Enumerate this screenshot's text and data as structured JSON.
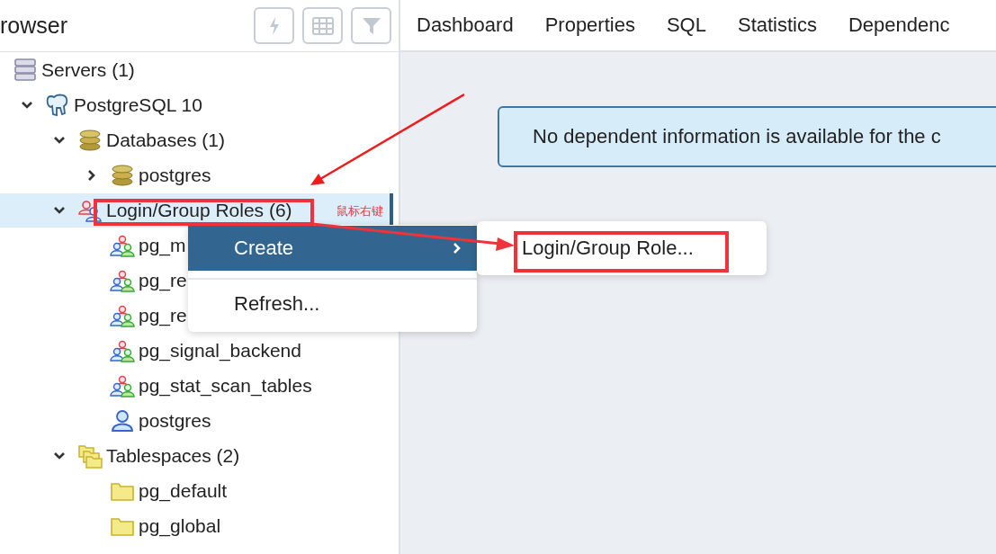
{
  "sidebar": {
    "title": "rowser"
  },
  "tree": [
    {
      "label": "Servers (1)",
      "kind": "servers",
      "selected": false,
      "children": [
        {
          "label": "PostgreSQL 10",
          "kind": "server",
          "expanded": true,
          "selected": false,
          "children": [
            {
              "label": "Databases (1)",
              "kind": "databases",
              "expanded": true,
              "selected": false,
              "children": [
                {
                  "label": "postgres",
                  "kind": "database",
                  "expanded": false,
                  "selected": false
                }
              ]
            },
            {
              "label": "Login/Group Roles (6)",
              "kind": "roles",
              "expanded": true,
              "selected": true,
              "children": [
                {
                  "label": "pg_m",
                  "kind": "group_role",
                  "selected": false
                },
                {
                  "label": "pg_re",
                  "kind": "group_role",
                  "selected": false
                },
                {
                  "label": "pg_re",
                  "kind": "group_role",
                  "selected": false
                },
                {
                  "label": "pg_signal_backend",
                  "kind": "group_role",
                  "selected": false
                },
                {
                  "label": "pg_stat_scan_tables",
                  "kind": "group_role",
                  "selected": false
                },
                {
                  "label": "postgres",
                  "kind": "login_role",
                  "selected": false
                }
              ]
            },
            {
              "label": "Tablespaces (2)",
              "kind": "tablespaces",
              "expanded": true,
              "selected": false,
              "children": [
                {
                  "label": "pg_default",
                  "kind": "tablespace",
                  "selected": false
                },
                {
                  "label": "pg_global",
                  "kind": "tablespace",
                  "selected": false
                }
              ]
            }
          ]
        }
      ]
    }
  ],
  "tabs": [
    {
      "label": "Dashboard",
      "selected": false
    },
    {
      "label": "Properties",
      "selected": false
    },
    {
      "label": "SQL",
      "selected": false
    },
    {
      "label": "Statistics",
      "selected": false
    },
    {
      "label": "Dependenc",
      "selected": false
    }
  ],
  "alert": {
    "text": "No dependent information is available for the c"
  },
  "context_menu": {
    "items": [
      {
        "label": "Create",
        "selected": true,
        "has_submenu": true
      },
      {
        "label": "Refresh...",
        "selected": false,
        "has_submenu": false
      }
    ]
  },
  "submenu": {
    "items": [
      {
        "label": "Login/Group Role...",
        "selected": false
      }
    ]
  },
  "annotation": {
    "note": "鼠标右键"
  }
}
